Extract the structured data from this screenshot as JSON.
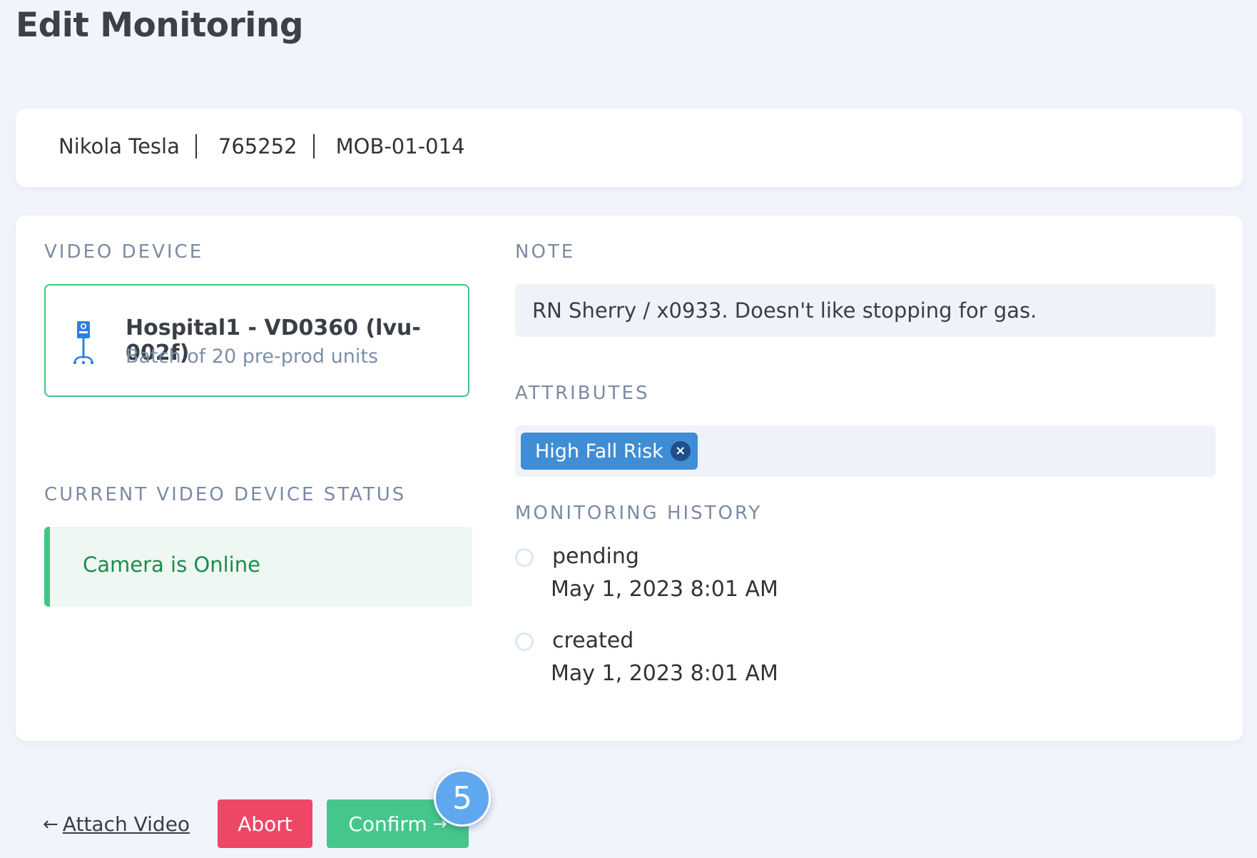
{
  "page": {
    "title": "Edit Monitoring"
  },
  "patient": {
    "name": "Nikola Tesla",
    "id": "765252",
    "room": "MOB-01-014"
  },
  "video_device": {
    "label": "VIDEO DEVICE",
    "icon": "iv-pole-camera-icon",
    "name": "Hospital1 - VD0360 (lvu-002f)",
    "description": "Batch of 20 pre-prod units"
  },
  "device_status": {
    "label": "CURRENT VIDEO DEVICE STATUS",
    "text": "Camera is Online",
    "color": "#1f8a4f"
  },
  "note": {
    "label": "NOTE",
    "value": "RN Sherry / x0933.  Doesn't like stopping for gas."
  },
  "attributes": {
    "label": "ATTRIBUTES",
    "tags": [
      {
        "label": "High Fall Risk",
        "remove_glyph": "×"
      }
    ]
  },
  "history": {
    "label": "MONITORING HISTORY",
    "items": [
      {
        "status": "pending",
        "time": "May 1, 2023 8:01 AM"
      },
      {
        "status": "created",
        "time": "May 1, 2023 8:01 AM"
      }
    ]
  },
  "footer": {
    "back_label": "Attach Video",
    "back_arrow": "←",
    "abort_label": "Abort",
    "confirm_label": "Confirm",
    "confirm_arrow": "→",
    "step_number": "5"
  },
  "colors": {
    "background": "#f1f4fb",
    "accent_green": "#45c78b",
    "abort_red": "#ee4766",
    "tag_blue": "#3f8dd4",
    "badge_blue": "#5fa8f0"
  }
}
